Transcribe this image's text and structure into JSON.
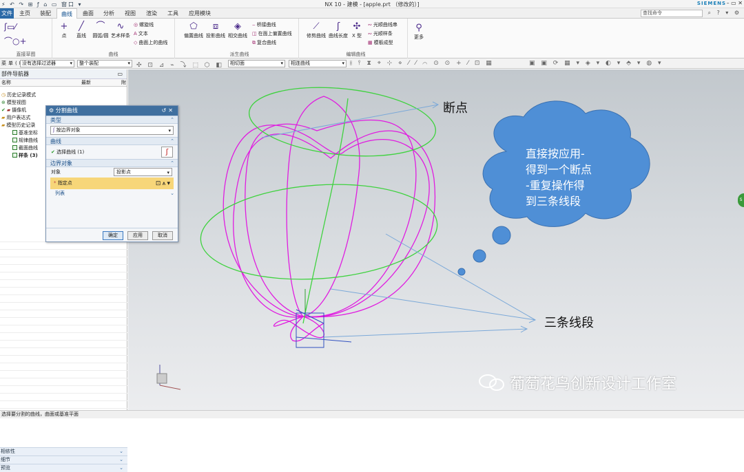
{
  "titlebar": {
    "quick_access": "⚡ ↶ ↷ ⊞ ƒ ⌂ ▭ 窗口 ▾",
    "title": "NX 10 - 建模 - [apple.prt （修改的）]",
    "brand": "SIEMENS",
    "window_controls": "– ▭ ✕"
  },
  "ribbon_tabs": {
    "file": "文件(F)",
    "tabs": [
      "主页",
      "装配",
      "曲线",
      "曲面",
      "分析",
      "视图",
      "渲染",
      "工具",
      "应用模块"
    ],
    "active": "曲线",
    "command_search_placeholder": "查找命令"
  },
  "ribbon": {
    "groups": [
      {
        "label": "直接草图"
      },
      {
        "label": "曲线"
      },
      {
        "label": "派生曲线"
      },
      {
        "label": "编辑曲线"
      }
    ],
    "curve_buttons": [
      {
        "label": "点",
        "icon": "point-icon"
      },
      {
        "label": "直线",
        "icon": "line-icon"
      },
      {
        "label": "圆弧/圆",
        "icon": "arc-icon"
      },
      {
        "label": "艺术样条",
        "icon": "spline-icon"
      }
    ],
    "curve_small": [
      "螺旋线",
      "文本",
      "曲面上的曲线"
    ],
    "derived_buttons": [
      {
        "label": "偏置曲线"
      },
      {
        "label": "投影曲线"
      },
      {
        "label": "相交曲线"
      }
    ],
    "derived_small": [
      "桥接曲线",
      "在面上偏置曲线",
      "复合曲线"
    ],
    "edit_buttons": [
      {
        "label": "修剪曲线"
      },
      {
        "label": "曲线长度"
      },
      {
        "label": "X 型"
      }
    ],
    "edit_small": [
      "光顺曲线串",
      "光顺样条",
      "模板成型"
    ],
    "more": "更多"
  },
  "selection_bar": {
    "menu": "菜单(M) ▾",
    "filter": "没有选择过滤器",
    "scope": "整个装配",
    "face_rule": "相切面",
    "curve_rule": "相连曲线"
  },
  "navigator": {
    "title": "部件导航器",
    "col_name": "名称",
    "col_latest": "最新",
    "col_extra": "附",
    "items": [
      {
        "label": "历史记录模式",
        "indent": 0
      },
      {
        "label": "模型视图",
        "indent": 0
      },
      {
        "label": "摄像机",
        "indent": 0
      },
      {
        "label": "用户表达式",
        "indent": 0
      },
      {
        "label": "模型历史记录",
        "indent": 0
      },
      {
        "label": "基准坐标",
        "indent": 1
      },
      {
        "label": "规律曲线",
        "indent": 1
      },
      {
        "label": "截面曲线",
        "indent": 1
      },
      {
        "label": "样条 (3)",
        "indent": 1
      }
    ],
    "panels": [
      "相依性",
      "细节",
      "预览"
    ]
  },
  "dialog": {
    "title": "分割曲线",
    "type_section": "类型",
    "type_value": "按边界对象",
    "curve_section": "曲线",
    "select_curve": "选择曲线 (1)",
    "boundary_section": "边界对象",
    "object_label": "对象",
    "object_value": "投影点",
    "specify_point": "指定点",
    "list_label": "列表",
    "ok": "确定",
    "apply": "应用",
    "cancel": "取消"
  },
  "annotations": {
    "break_point": "断点",
    "cloud_lines": [
      "直接按应用-",
      "得到一个断点",
      "-重复操作得",
      "到三条线段"
    ],
    "three_segments": "三条线段",
    "watermark": "葡萄花鸟创新设计工作室"
  },
  "statusbar": {
    "text": "选择要分割的曲线，曲面或基准平面"
  },
  "colors": {
    "curve_magenta": "#e01ce0",
    "curve_green": "#3fd23f",
    "cloud_blue": "#4f8fd6",
    "arrow_blue": "#7aa8d8",
    "file_tab": "#2b6aa8",
    "dialog_title": "#3f6f9f",
    "point_highlight": "#f7d679"
  }
}
